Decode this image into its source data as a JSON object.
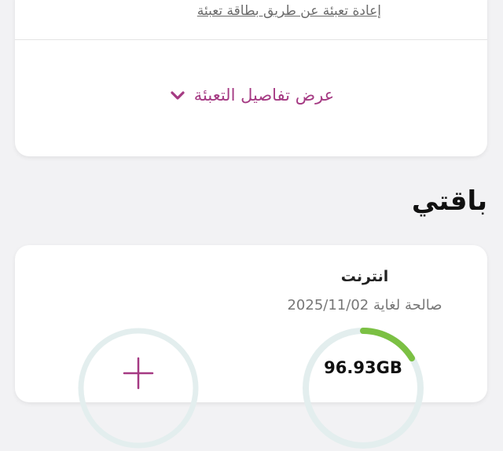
{
  "recharge": {
    "card_link": "إعادة تعبئة عن طريق بطاقة تعبئة",
    "details_toggle": "عرض تفاصيل التعبئة",
    "details_icon": "chevron-down-icon"
  },
  "my_package": {
    "section_title": "باقتي",
    "item": {
      "name": "انترنت",
      "validity": "صالحة لغاية 2025/11/02",
      "remaining": "96.93GB"
    },
    "add_icon": "plus-icon"
  },
  "colors": {
    "accent": "#a53a83",
    "usage_ring": "#7bc043",
    "ring_track": "#e3eeee",
    "background": "#f2f2f4"
  }
}
